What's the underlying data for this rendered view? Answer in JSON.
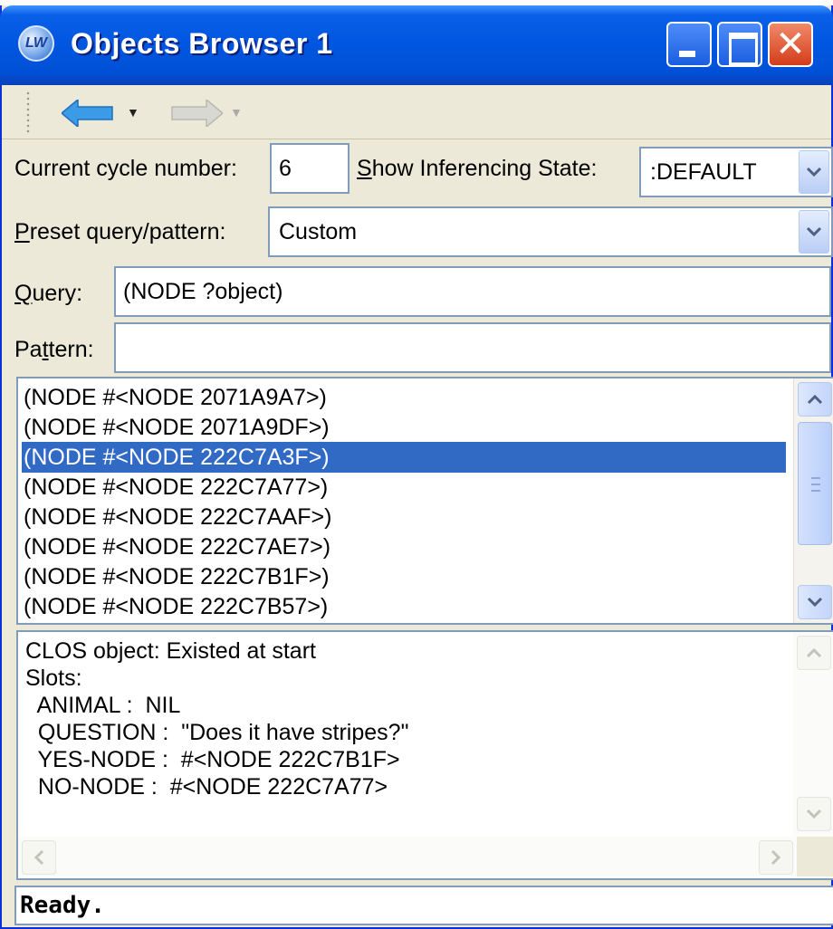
{
  "window": {
    "title": "Objects Browser 1",
    "icon_label": "LW"
  },
  "form": {
    "cycle_label": "Current cycle number:",
    "cycle_value": "6",
    "inferencing_label_prefix": "S",
    "inferencing_label_rest": "how Inferencing State:",
    "inferencing_value": ":DEFAULT",
    "preset_label_prefix": "P",
    "preset_label_rest": "reset query/pattern:",
    "preset_value": "Custom",
    "query_label_prefix": "Q",
    "query_label_rest": "uery:",
    "query_value": "(NODE ?object)",
    "pattern_label_prefix": "Pa",
    "pattern_label_u": "t",
    "pattern_label_rest": "tern:",
    "pattern_value": ""
  },
  "list": {
    "selected_index": 2,
    "items": [
      "(NODE #<NODE 2071A9A7>)",
      "(NODE #<NODE 2071A9DF>)",
      "(NODE #<NODE 222C7A3F>)",
      "(NODE #<NODE 222C7A77>)",
      "(NODE #<NODE 222C7AAF>)",
      "(NODE #<NODE 222C7AE7>)",
      "(NODE #<NODE 222C7B1F>)",
      "(NODE #<NODE 222C7B57>)"
    ]
  },
  "detail": {
    "lines": [
      "CLOS object: Existed at start",
      "Slots:",
      "  ANIMAL :  NIL",
      "  QUESTION :  \"Does it have stripes?\"",
      "  YES-NODE :  #<NODE 222C7B1F>",
      "  NO-NODE :  #<NODE 222C7A77>"
    ]
  },
  "status": {
    "text": "Ready."
  },
  "colors": {
    "titlebar": "#0056e0",
    "selection": "#316ac5",
    "window_face": "#ece9d8",
    "field_border": "#7f9db9",
    "nav_arrow": "#3c9be6"
  },
  "icons": {
    "back": "back-arrow-icon",
    "forward": "forward-arrow-icon",
    "dropdown": "chevron-down-icon"
  }
}
